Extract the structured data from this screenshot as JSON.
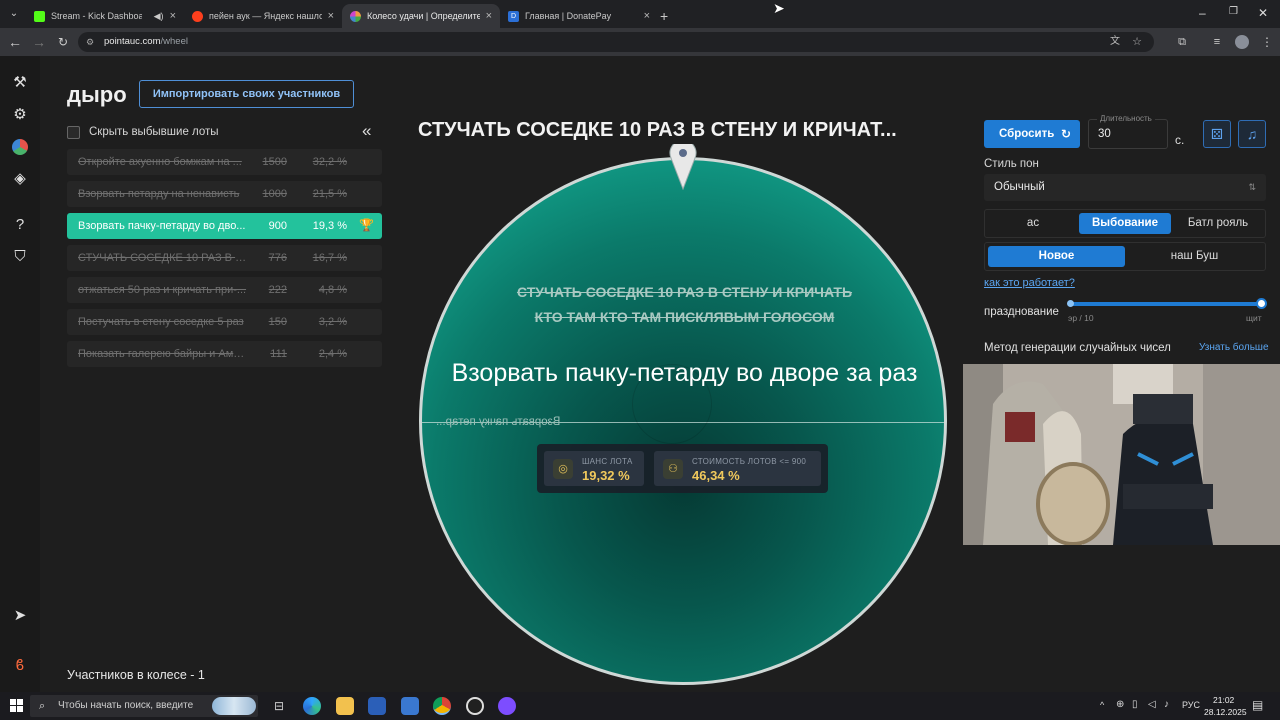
{
  "browser": {
    "tabs": [
      {
        "label": "Stream - Kick Dashboard",
        "favicon_color": "#53fc18"
      },
      {
        "label": "пейен аук — Яндекс нашлось",
        "favicon_color": "#fc3f1d"
      },
      {
        "label": "Колесо удачи | Определите п...",
        "favicon_color": "#d0d0d0"
      },
      {
        "label": "Главная | DonatePay",
        "favicon_color": "#2b6fd6"
      }
    ],
    "tab_icons": {
      "favicon_letter_4": "D"
    },
    "url_host": "pointauc.com",
    "url_path": "/wheel"
  },
  "left_panel": {
    "title": "дыро",
    "import_button": "Импортировать своих участников",
    "hide_label": "Скрыть выбывшие лоты",
    "lots": [
      {
        "name": "Откройте ахуенно бомжам на ...",
        "value": "1500",
        "percent": "32,2 %",
        "struck": true
      },
      {
        "name": "Взорвать петарду на ненависть",
        "value": "1000",
        "percent": "21,5 %",
        "struck": true
      },
      {
        "name": "Взорвать пачку-петарду во дво...",
        "value": "900",
        "percent": "19,3 %",
        "struck": false
      },
      {
        "name": "СТУЧАТЬ СОСЕДКЕ 10 РАЗ В СТ...",
        "value": "776",
        "percent": "16,7 %",
        "struck": true
      },
      {
        "name": "отжаться 50 раз и кричать при-...",
        "value": "222",
        "percent": "4,8 %",
        "struck": true
      },
      {
        "name": "Постучать в стену соседке 5 раз",
        "value": "150",
        "percent": "3,2 %",
        "struck": true
      },
      {
        "name": "Показать галерею байры и Амы-...",
        "value": "111",
        "percent": "2,4 %",
        "struck": true
      }
    ],
    "participants_count": "Участников в колесе - 1"
  },
  "wheel": {
    "title": "СТУЧАТЬ СОСЕДКЕ 10 РАЗ В СТЕНУ И КРИЧАТ...",
    "struck_segment": "СТУЧАТЬ СОСЕДКЕ 10 РАЗ В СТЕНУ И КРИЧАТЬ КТО ТАМ КТО ТАМ ПИСКЛЯВЫМ ГОЛОСОМ",
    "winner": "Взорвать пачку-петарду во дворе за раз",
    "mirrored_label": "Взорвать пачку петар...",
    "stats": [
      {
        "label": "ШАНС ЛОТА",
        "value": "19,32 %"
      },
      {
        "label": "СТОИМОСТЬ ЛОТОВ <= 900",
        "value": "46,34 %"
      }
    ],
    "colors": {
      "teal": "#1bb59c",
      "dark": "#053a34",
      "accent": "#f0c95c"
    }
  },
  "right_panel": {
    "reset_button": "Сбросить",
    "duration_label": "Длительность",
    "duration_value": "30",
    "duration_unit": "с.",
    "style_label": "Стиль пон",
    "style_value": "Обычный",
    "mode_options": [
      "ас",
      "Выбование",
      "Батл рояль"
    ],
    "mode_selected": "Выбование",
    "order_options": [
      "Новое",
      "наш Буш"
    ],
    "order_selected": "Новое",
    "how_link": "как это работает?",
    "celebration_label": "празднование",
    "slider_min": "эр / 10",
    "slider_max": "щит",
    "slider_level": 1.0,
    "rng_label": "Метод генерации случайных чисел",
    "rng_link": "Узнать больше"
  },
  "taskbar": {
    "search_placeholder": "Чтобы начать поиск, введите",
    "lang": "РУС",
    "time": "21:02",
    "date": "28.12.2025"
  }
}
